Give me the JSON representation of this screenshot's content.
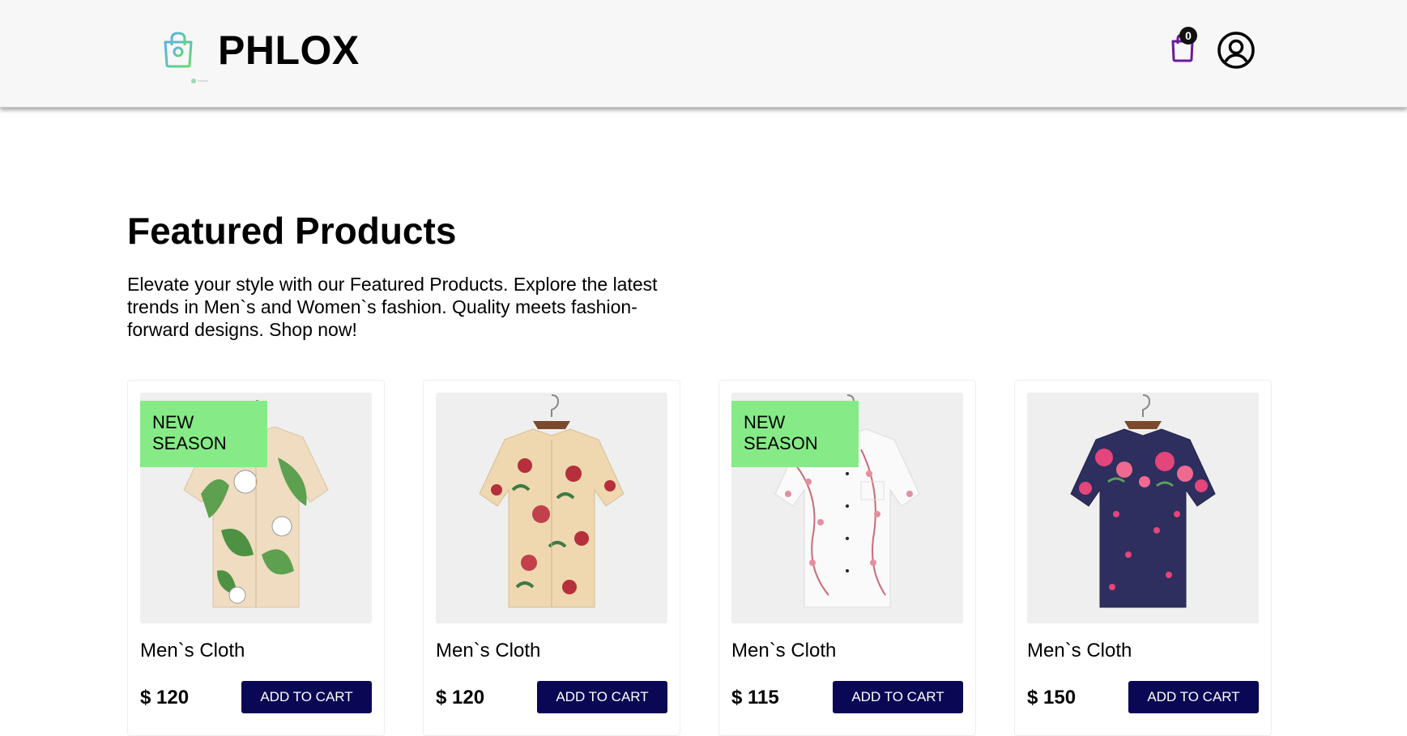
{
  "header": {
    "brand": "PHLOX",
    "cart_count": "0"
  },
  "featured": {
    "title": "Featured Products",
    "description": "Elevate your style with our Featured Products. Explore the latest trends in Men`s and Women`s fashion. Quality meets fashion-forward designs. Shop now!"
  },
  "products": [
    {
      "name": "Men`s Cloth",
      "price": "$ 120",
      "badge": "NEW SEASON",
      "button": "ADD TO CART",
      "pattern": "green-leaf-floral"
    },
    {
      "name": "Men`s Cloth",
      "price": "$ 120",
      "badge": "",
      "button": "ADD TO CART",
      "pattern": "beige-red-floral"
    },
    {
      "name": "Men`s Cloth",
      "price": "$ 115",
      "badge": "NEW SEASON",
      "button": "ADD TO CART",
      "pattern": "white-pink-blossom"
    },
    {
      "name": "Men`s Cloth",
      "price": "$ 150",
      "badge": "",
      "button": "ADD TO CART",
      "pattern": "navy-pink-floral"
    }
  ],
  "colors": {
    "button_bg": "#0a0754",
    "badge_bg": "#86eb86",
    "cart_icon": "#6a1b9a"
  },
  "icons": {
    "logo": "shopping-bag-icon",
    "cart": "cart-bag-icon",
    "user": "user-circle-icon"
  }
}
